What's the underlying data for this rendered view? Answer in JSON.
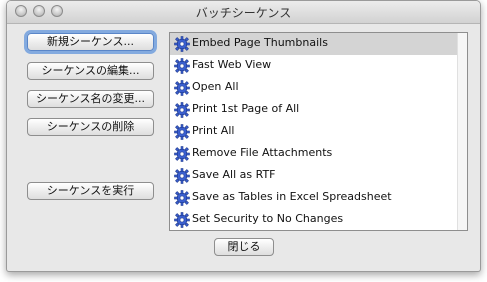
{
  "window": {
    "title": "バッチシーケンス"
  },
  "buttons": {
    "new_sequence": "新規シーケンス...",
    "edit_sequence": "シーケンスの編集...",
    "rename_sequence": "シーケンス名の変更...",
    "delete_sequence": "シーケンスの削除",
    "run_sequence": "シーケンスを実行",
    "close": "閉じる"
  },
  "sequence_list": {
    "selected_index": 0,
    "items": [
      {
        "label": "Embed Page Thumbnails",
        "icon": "gear-icon"
      },
      {
        "label": "Fast Web View",
        "icon": "gear-icon"
      },
      {
        "label": "Open All",
        "icon": "gear-icon"
      },
      {
        "label": "Print 1st Page of All",
        "icon": "gear-icon"
      },
      {
        "label": "Print All",
        "icon": "gear-icon"
      },
      {
        "label": "Remove File Attachments",
        "icon": "gear-icon"
      },
      {
        "label": "Save All as RTF",
        "icon": "gear-icon"
      },
      {
        "label": "Save as Tables in Excel Spreadsheet",
        "icon": "gear-icon"
      },
      {
        "label": "Set Security to No Changes",
        "icon": "gear-icon"
      }
    ]
  },
  "colors": {
    "selection": "#d4d4d4",
    "focus_ring": "#6296dc",
    "gear_blue": "#3a5fd0"
  }
}
